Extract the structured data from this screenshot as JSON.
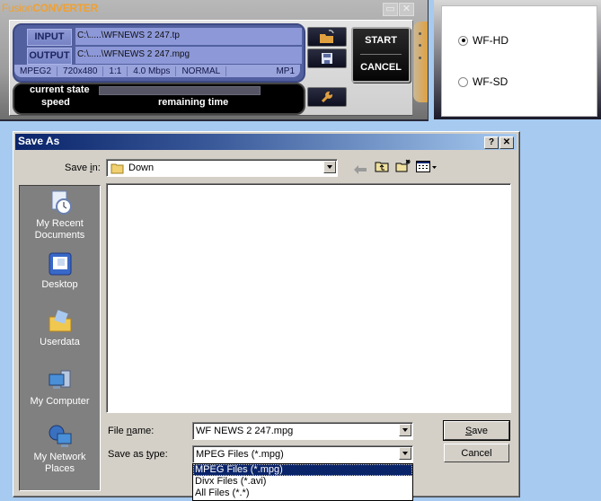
{
  "converter": {
    "title_part1": "Fusion",
    "title_part2": "CONVERTER",
    "minimize_icon": "minimize-icon",
    "close_icon": "close-icon",
    "input_label": "INPUT",
    "input_path": "C:\\.....\\WFNEWS 2   247.tp",
    "output_label": "OUTPUT",
    "output_path": "C:\\.....\\WFNEWS 2   247.mpg",
    "format_info": [
      "MPEG2",
      "720x480",
      "1:1",
      "4.0 Mbps",
      "NORMAL",
      "MP1"
    ],
    "current_state_label": "current state",
    "speed_label": "speed",
    "remaining_time_label": "remaining time",
    "progress": 0,
    "start_label": "START",
    "cancel_label": "CANCEL"
  },
  "mode_panel": {
    "options": [
      {
        "label": "WF-HD",
        "selected": true
      },
      {
        "label": "WF-SD",
        "selected": false
      }
    ]
  },
  "save_dialog": {
    "title": "Save As",
    "help_label": "?",
    "close_label": "✕",
    "save_in_label_a": "Save ",
    "save_in_label_u": "i",
    "save_in_label_b": "n:",
    "save_in_value": "Down",
    "places": [
      {
        "label_1": "My Recent",
        "label_2": "Documents",
        "icon": "recent-documents-icon"
      },
      {
        "label_1": "Desktop",
        "label_2": "",
        "icon": "desktop-icon"
      },
      {
        "label_1": "Userdata",
        "label_2": "",
        "icon": "folder-icon"
      },
      {
        "label_1": "My Computer",
        "label_2": "",
        "icon": "my-computer-icon"
      },
      {
        "label_1": "My Network",
        "label_2": "Places",
        "icon": "network-places-icon"
      }
    ],
    "file_name_label_a": "File ",
    "file_name_label_u": "n",
    "file_name_label_b": "ame:",
    "file_name_value": "WF NEWS 2   247.mpg",
    "save_type_label_a": "Save as ",
    "save_type_label_u": "t",
    "save_type_label_b": "ype:",
    "save_type_value": "MPEG Files (*.mpg)",
    "save_type_options": [
      "MPEG Files (*.mpg)",
      "Divx Files (*.avi)",
      "All Files (*.*)"
    ],
    "save_button_u": "S",
    "save_button_rest": "ave",
    "cancel_button": "Cancel"
  }
}
